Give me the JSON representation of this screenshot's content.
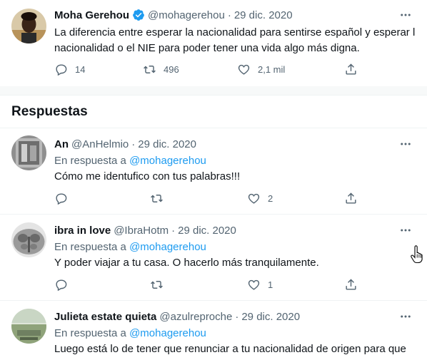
{
  "main_tweet": {
    "name": "Moha Gerehou",
    "handle": "@mohagerehou",
    "date": "29 dic. 2020",
    "text_line1": "La diferencia entre esperar la nacionalidad para sentirse español y esperar la",
    "text_line2": "nacionalidad o el NIE para poder tener una vida algo más digna.",
    "replies": "14",
    "retweets": "496",
    "likes": "2,1 mil"
  },
  "section": {
    "title": "Respuestas"
  },
  "replies": [
    {
      "name": "An",
      "handle": "@AnHelmio",
      "date": "29 dic. 2020",
      "reply_prefix": "En respuesta a",
      "mention": "@mohagerehou",
      "text": "Cómo me identufico con tus palabras!!!",
      "likes": "2"
    },
    {
      "name": "ibra in love",
      "handle": "@IbraHotm",
      "date": "29 dic. 2020",
      "reply_prefix": "En respuesta a",
      "mention": "@mohagerehou",
      "text": "Y poder viajar a tu casa. O hacerlo más tranquilamente.",
      "likes": "1"
    },
    {
      "name": "Julieta estate quieta",
      "handle": "@azulreproche",
      "date": "29 dic. 2020",
      "reply_prefix": "En respuesta a",
      "mention": "@mohagerehou",
      "text": "Luego está lo de tener que renunciar a tu nacionalidad de origen para que"
    }
  ],
  "ui": {
    "dot": "·",
    "accent": "#1d9bf0",
    "muted": "#536471"
  }
}
